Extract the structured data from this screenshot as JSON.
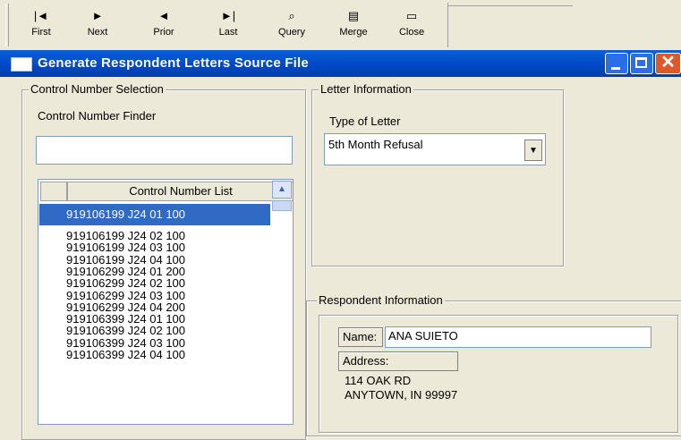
{
  "toolbar": {
    "buttons": [
      {
        "label": "First",
        "icon": "|◄"
      },
      {
        "label": "Next",
        "icon": "►"
      },
      {
        "label": "Prior",
        "icon": "◄"
      },
      {
        "label": "Last",
        "icon": "►|"
      },
      {
        "label": "Query",
        "icon": "⌕"
      },
      {
        "label": "Merge",
        "icon": "▤"
      },
      {
        "label": "Close",
        "icon": "▭"
      }
    ]
  },
  "window": {
    "title": "Generate Respondent Letters Source File",
    "close_glyph": "✕"
  },
  "control_section": {
    "group_label": "Control Number Selection",
    "finder_label": "Control Number Finder",
    "finder_value": "",
    "list_header": "Control Number List",
    "scroll_up_glyph": "▲",
    "selected_item": "919106199  J24 01 100",
    "items": [
      "919106199  J24 02 100",
      "919106199  J24 03 100",
      "919106199  J24 04 100",
      "919106299  J24 01 200",
      "919106299  J24 02 100",
      "919106299  J24 03 100",
      "919106299  J24 04 200",
      "919106399  J24 01 100",
      "919106399  J24 02 100",
      "919106399  J24 03 100",
      "919106399  J24 04 100"
    ]
  },
  "letter_section": {
    "group_label": "Letter Information",
    "type_label": "Type of Letter",
    "type_value": "5th Month Refusal",
    "dropdown_glyph": "▼"
  },
  "respondent_section": {
    "group_label": "Respondent Information",
    "name_label": "Name:",
    "name_value": "ANA SUIETO",
    "address_label": "Address:",
    "address_line1": "114 OAK RD",
    "address_line2": "ANYTOWN, IN  99997"
  },
  "colors": {
    "titlebar": "#0047c4",
    "selection": "#316ac5",
    "window_bg": "#ece9d8",
    "close_button": "#e0582a"
  }
}
